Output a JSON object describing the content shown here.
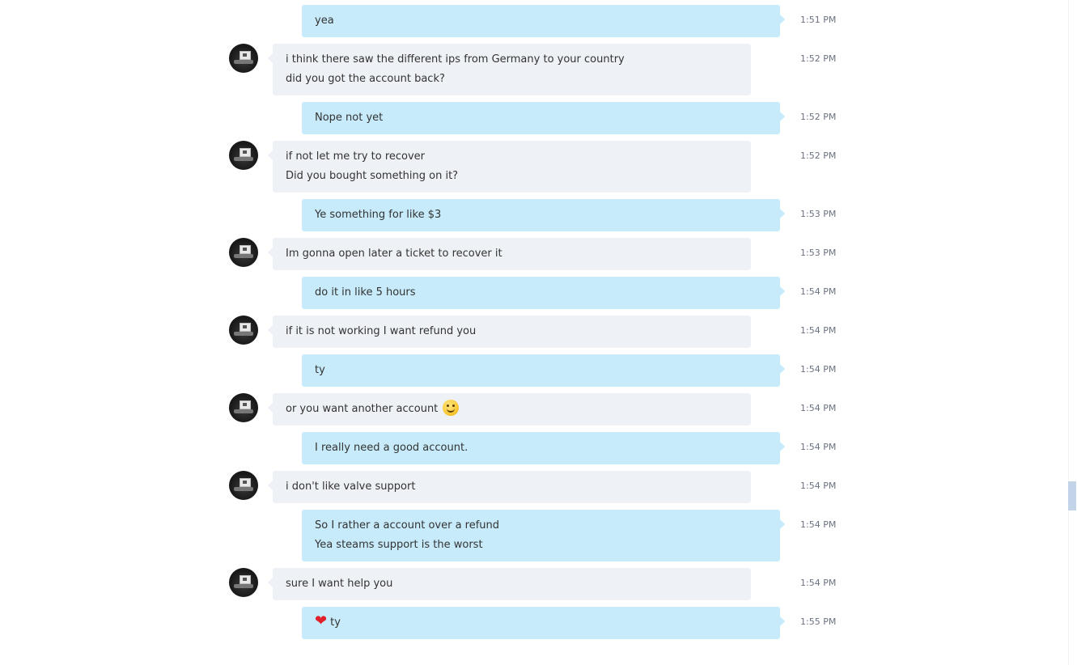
{
  "messages": [
    {
      "dir": "out",
      "lines": [
        "yea"
      ],
      "time": "1:51 PM"
    },
    {
      "dir": "in",
      "lines": [
        "i think there saw the different ips from Germany to your country",
        "did you got the account back?"
      ],
      "time": "1:52 PM"
    },
    {
      "dir": "out",
      "lines": [
        "Nope not yet"
      ],
      "time": "1:52 PM"
    },
    {
      "dir": "in",
      "lines": [
        "if not let me try to recover",
        "Did you bought something on it?"
      ],
      "time": "1:52 PM"
    },
    {
      "dir": "out",
      "lines": [
        "Ye something for like $3"
      ],
      "time": "1:53 PM"
    },
    {
      "dir": "in",
      "lines": [
        "Im gonna open later a ticket to recover it"
      ],
      "time": "1:53 PM"
    },
    {
      "dir": "out",
      "lines": [
        "do it in like 5 hours"
      ],
      "time": "1:54 PM"
    },
    {
      "dir": "in",
      "lines": [
        "if it is not working I want refund you"
      ],
      "time": "1:54 PM"
    },
    {
      "dir": "out",
      "lines": [
        "ty"
      ],
      "time": "1:54 PM"
    },
    {
      "dir": "in",
      "lines": [
        "or you want another account"
      ],
      "time": "1:54 PM",
      "emoji": "smile-emoji"
    },
    {
      "dir": "out",
      "lines": [
        "I really need a good account."
      ],
      "time": "1:54 PM"
    },
    {
      "dir": "in",
      "lines": [
        "i don't like valve support"
      ],
      "time": "1:54 PM"
    },
    {
      "dir": "out",
      "lines": [
        "So I rather a account over a refund",
        "Yea steams support is the worst"
      ],
      "time": "1:54 PM"
    },
    {
      "dir": "in",
      "lines": [
        "sure I want help you"
      ],
      "time": "1:54 PM"
    },
    {
      "dir": "out",
      "lines": [
        "ty"
      ],
      "time": "1:55 PM",
      "lead_icon": "heart-icon"
    }
  ],
  "avatar_icon": "contact-avatar",
  "scrollbar": {
    "position_fraction": 0.73
  }
}
